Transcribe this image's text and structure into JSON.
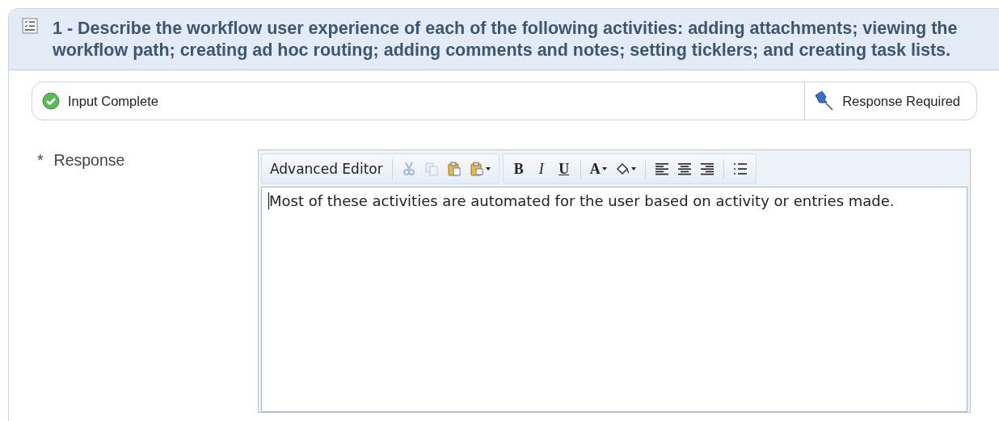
{
  "question": {
    "title": "1 - Describe the workflow user experience of each of the following activities: adding attachments; viewing the workflow path; creating ad hoc routing; adding comments and notes; setting ticklers; and creating task lists."
  },
  "status": {
    "input_complete": true,
    "input_label": "Input Complete",
    "response_required": true,
    "required_label": "Response Required"
  },
  "response": {
    "required_mark": "*",
    "label": "Response",
    "toolbars": [
      {
        "items": [
          {
            "kind": "text",
            "label": "Advanced Editor",
            "disabled": false
          },
          {
            "kind": "separator"
          },
          {
            "kind": "cut",
            "disabled": true
          },
          {
            "kind": "copy",
            "disabled": true
          },
          {
            "kind": "paste",
            "disabled": false
          },
          {
            "kind": "paste-menu",
            "disabled": false
          }
        ]
      },
      {
        "items": [
          {
            "kind": "bold",
            "label": "B",
            "disabled": false
          },
          {
            "kind": "italic",
            "label": "I",
            "disabled": false
          },
          {
            "kind": "underline",
            "label": "U",
            "disabled": false
          },
          {
            "kind": "separator"
          },
          {
            "kind": "font-color",
            "label": "A",
            "disabled": false
          },
          {
            "kind": "fill",
            "disabled": false
          },
          {
            "kind": "separator"
          },
          {
            "kind": "align-left",
            "disabled": false
          },
          {
            "kind": "align-center",
            "disabled": false
          },
          {
            "kind": "align-right",
            "disabled": false
          },
          {
            "kind": "separator"
          },
          {
            "kind": "bullets",
            "disabled": false
          }
        ]
      }
    ],
    "value": "Most of these activities are automated for the user based on activity or entries made."
  }
}
